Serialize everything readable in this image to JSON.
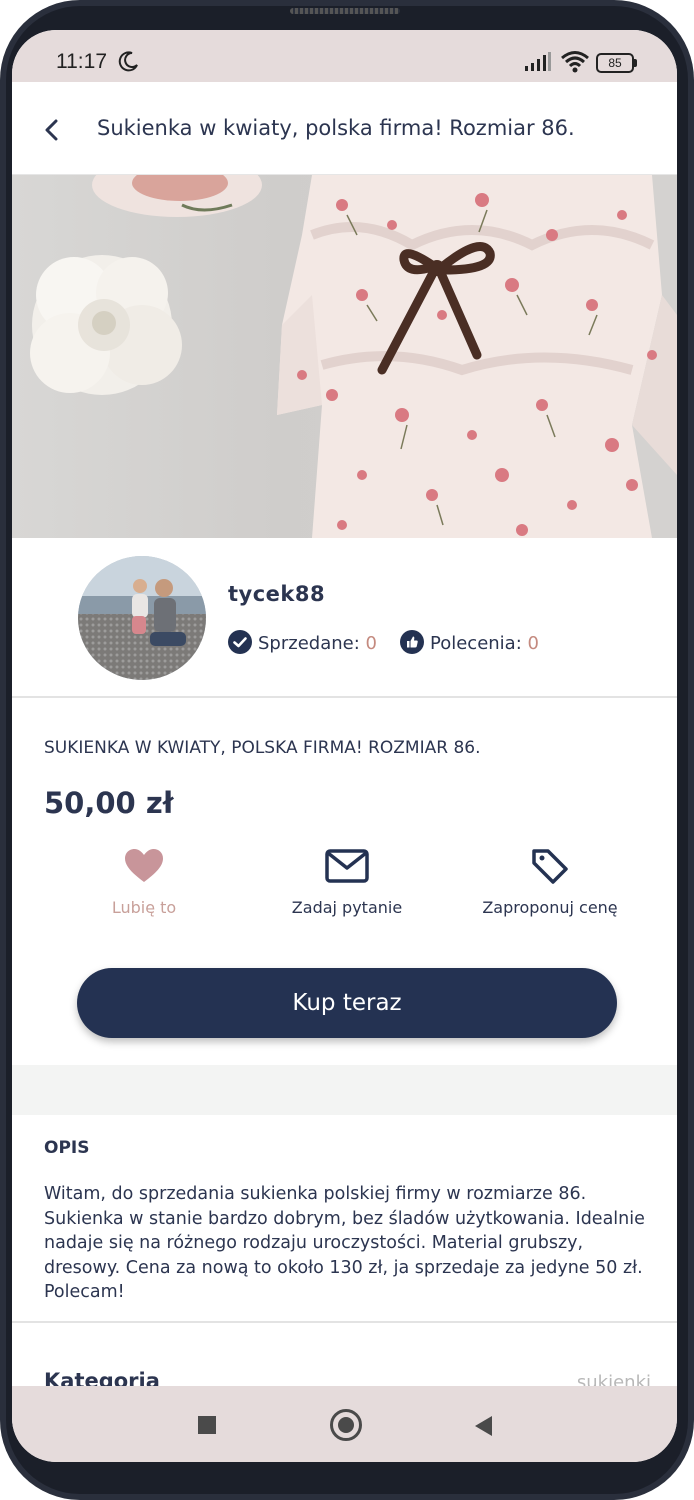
{
  "status_bar": {
    "time": "11:17",
    "battery": "85",
    "icons": [
      "moon-icon",
      "signal-icon",
      "wifi-icon",
      "battery-icon"
    ]
  },
  "header": {
    "back_icon": "chevron-left-icon",
    "title": "Sukienka w kwiaty, polska firma! Rozmiar 86."
  },
  "hero": {
    "image": "floral-dress-photo"
  },
  "seller": {
    "username": "tycek88",
    "sold_label": "Sprzedane:",
    "sold_count": "0",
    "recommend_label": "Polecenia:",
    "recommend_count": "0"
  },
  "product": {
    "name": "SUKIENKA W KWIATY, POLSKA FIRMA! ROZMIAR 86.",
    "price": "50,00 zł"
  },
  "actions": {
    "like_label": "Lubię to",
    "ask_label": "Zadaj pytanie",
    "offer_label": "Zaproponuj cenę",
    "buy_label": "Kup teraz"
  },
  "description": {
    "heading": "OPIS",
    "text": "Witam, do sprzedania sukienka polskiej firmy w rozmiarze 86. Sukienka w stanie bardzo dobrym, bez śladów użytkowania. Idealnie nadaje się na różnego rodzaju uroczystości. Material grubszy, dresowy. Cena za nową to około 130 zł, ja sprzedaje za jedyne 50 zł. Polecam!"
  },
  "details": {
    "category_label": "Kategoria",
    "category_value": "sukienki"
  },
  "colors": {
    "primary": "#243252",
    "accent": "#c48a7f",
    "like": "#c8959a",
    "bar_bg": "#e5dbdb"
  }
}
